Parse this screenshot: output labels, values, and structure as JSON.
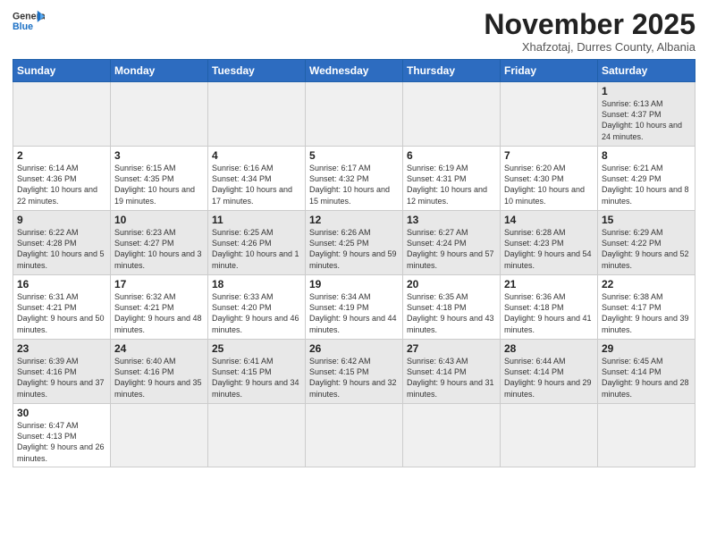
{
  "logo": {
    "line1": "General",
    "line2": "Blue"
  },
  "title": "November 2025",
  "location": "Xhafzotaj, Durres County, Albania",
  "days_of_week": [
    "Sunday",
    "Monday",
    "Tuesday",
    "Wednesday",
    "Thursday",
    "Friday",
    "Saturday"
  ],
  "weeks": [
    [
      {
        "num": "",
        "info": ""
      },
      {
        "num": "",
        "info": ""
      },
      {
        "num": "",
        "info": ""
      },
      {
        "num": "",
        "info": ""
      },
      {
        "num": "",
        "info": ""
      },
      {
        "num": "",
        "info": ""
      },
      {
        "num": "1",
        "info": "Sunrise: 6:13 AM\nSunset: 4:37 PM\nDaylight: 10 hours and 24 minutes."
      }
    ],
    [
      {
        "num": "2",
        "info": "Sunrise: 6:14 AM\nSunset: 4:36 PM\nDaylight: 10 hours and 22 minutes."
      },
      {
        "num": "3",
        "info": "Sunrise: 6:15 AM\nSunset: 4:35 PM\nDaylight: 10 hours and 19 minutes."
      },
      {
        "num": "4",
        "info": "Sunrise: 6:16 AM\nSunset: 4:34 PM\nDaylight: 10 hours and 17 minutes."
      },
      {
        "num": "5",
        "info": "Sunrise: 6:17 AM\nSunset: 4:32 PM\nDaylight: 10 hours and 15 minutes."
      },
      {
        "num": "6",
        "info": "Sunrise: 6:19 AM\nSunset: 4:31 PM\nDaylight: 10 hours and 12 minutes."
      },
      {
        "num": "7",
        "info": "Sunrise: 6:20 AM\nSunset: 4:30 PM\nDaylight: 10 hours and 10 minutes."
      },
      {
        "num": "8",
        "info": "Sunrise: 6:21 AM\nSunset: 4:29 PM\nDaylight: 10 hours and 8 minutes."
      }
    ],
    [
      {
        "num": "9",
        "info": "Sunrise: 6:22 AM\nSunset: 4:28 PM\nDaylight: 10 hours and 5 minutes."
      },
      {
        "num": "10",
        "info": "Sunrise: 6:23 AM\nSunset: 4:27 PM\nDaylight: 10 hours and 3 minutes."
      },
      {
        "num": "11",
        "info": "Sunrise: 6:25 AM\nSunset: 4:26 PM\nDaylight: 10 hours and 1 minute."
      },
      {
        "num": "12",
        "info": "Sunrise: 6:26 AM\nSunset: 4:25 PM\nDaylight: 9 hours and 59 minutes."
      },
      {
        "num": "13",
        "info": "Sunrise: 6:27 AM\nSunset: 4:24 PM\nDaylight: 9 hours and 57 minutes."
      },
      {
        "num": "14",
        "info": "Sunrise: 6:28 AM\nSunset: 4:23 PM\nDaylight: 9 hours and 54 minutes."
      },
      {
        "num": "15",
        "info": "Sunrise: 6:29 AM\nSunset: 4:22 PM\nDaylight: 9 hours and 52 minutes."
      }
    ],
    [
      {
        "num": "16",
        "info": "Sunrise: 6:31 AM\nSunset: 4:21 PM\nDaylight: 9 hours and 50 minutes."
      },
      {
        "num": "17",
        "info": "Sunrise: 6:32 AM\nSunset: 4:21 PM\nDaylight: 9 hours and 48 minutes."
      },
      {
        "num": "18",
        "info": "Sunrise: 6:33 AM\nSunset: 4:20 PM\nDaylight: 9 hours and 46 minutes."
      },
      {
        "num": "19",
        "info": "Sunrise: 6:34 AM\nSunset: 4:19 PM\nDaylight: 9 hours and 44 minutes."
      },
      {
        "num": "20",
        "info": "Sunrise: 6:35 AM\nSunset: 4:18 PM\nDaylight: 9 hours and 43 minutes."
      },
      {
        "num": "21",
        "info": "Sunrise: 6:36 AM\nSunset: 4:18 PM\nDaylight: 9 hours and 41 minutes."
      },
      {
        "num": "22",
        "info": "Sunrise: 6:38 AM\nSunset: 4:17 PM\nDaylight: 9 hours and 39 minutes."
      }
    ],
    [
      {
        "num": "23",
        "info": "Sunrise: 6:39 AM\nSunset: 4:16 PM\nDaylight: 9 hours and 37 minutes."
      },
      {
        "num": "24",
        "info": "Sunrise: 6:40 AM\nSunset: 4:16 PM\nDaylight: 9 hours and 35 minutes."
      },
      {
        "num": "25",
        "info": "Sunrise: 6:41 AM\nSunset: 4:15 PM\nDaylight: 9 hours and 34 minutes."
      },
      {
        "num": "26",
        "info": "Sunrise: 6:42 AM\nSunset: 4:15 PM\nDaylight: 9 hours and 32 minutes."
      },
      {
        "num": "27",
        "info": "Sunrise: 6:43 AM\nSunset: 4:14 PM\nDaylight: 9 hours and 31 minutes."
      },
      {
        "num": "28",
        "info": "Sunrise: 6:44 AM\nSunset: 4:14 PM\nDaylight: 9 hours and 29 minutes."
      },
      {
        "num": "29",
        "info": "Sunrise: 6:45 AM\nSunset: 4:14 PM\nDaylight: 9 hours and 28 minutes."
      }
    ],
    [
      {
        "num": "30",
        "info": "Sunrise: 6:47 AM\nSunset: 4:13 PM\nDaylight: 9 hours and 26 minutes."
      },
      {
        "num": "",
        "info": ""
      },
      {
        "num": "",
        "info": ""
      },
      {
        "num": "",
        "info": ""
      },
      {
        "num": "",
        "info": ""
      },
      {
        "num": "",
        "info": ""
      },
      {
        "num": "",
        "info": ""
      }
    ]
  ]
}
